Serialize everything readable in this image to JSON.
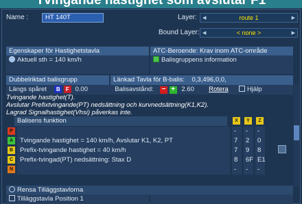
{
  "banner": {
    "title": "Tvingande hastighet som avslutar F1"
  },
  "header": {
    "name_label": "Name :",
    "name_value": "HT 140T",
    "layer_label": "Layer:",
    "layer_value": "route 1",
    "bound_layer_label": "Bound Layer:",
    "bound_layer_value": "< none >"
  },
  "sections": {
    "egenskaper": "Egenskaper för Hastighetstavla",
    "atc": "ATC-Beroende: Krav inom ATC-område",
    "aktuell": "Aktuell sth = 140 km/h",
    "balisgrupp_info": "Balisgruppens information",
    "dubbelriktad": "Dubbelriktad balisgrupp",
    "lankad": "Länkad Tavla för B-balis:",
    "lankad_value": "0,3,496,0,0,",
    "langs": "Längs spåret",
    "langs_b": "B",
    "langs_f": "F",
    "langs_value": "0.00",
    "avstand": "Balisavstånd:",
    "avstand_value": "2.60",
    "rotera": "Rotera",
    "hjalp": "Hjälp"
  },
  "notes": [
    "Tvingande hastighet(T).",
    "Avslutar Prefixtvingande(PT) nedsättning och kurvnedsättning(K1,K2).",
    "Lagrad Signalhastighet(Vhsi) påverkas inte."
  ],
  "table": {
    "header": "Balisens funktion",
    "col_headers": [
      "X",
      "Y",
      "Z"
    ],
    "rows": [
      {
        "tag": "P",
        "tag_color": "#d83a1e",
        "label": "",
        "x": "-",
        "y": "-",
        "z": "-"
      },
      {
        "tag": "A",
        "tag_color": "#3cc43c",
        "label": "Tvingande hastighet = 140 km/h, Avslutar K1, K2, PT",
        "x": "7",
        "y": "2",
        "z": "0"
      },
      {
        "tag": "B",
        "tag_color": "#e6c61a",
        "label": "Prefix-tvingande hastighet = 40 km/h",
        "x": "7",
        "y": "9",
        "z": "8"
      },
      {
        "tag": "C",
        "tag_color": "#e6c61a",
        "label": "Prefix-tvingad(PT) nedsättning: Stax D",
        "x": "8",
        "y": "6F",
        "z": "E1"
      },
      {
        "tag": "N",
        "tag_color": "#e0781a",
        "label": "",
        "x": "-",
        "y": "-",
        "z": "-"
      }
    ]
  },
  "footer": {
    "rensa": "Rensa Tilläggstavlorna",
    "tillagg": "Tilläggstavla Position 1"
  }
}
